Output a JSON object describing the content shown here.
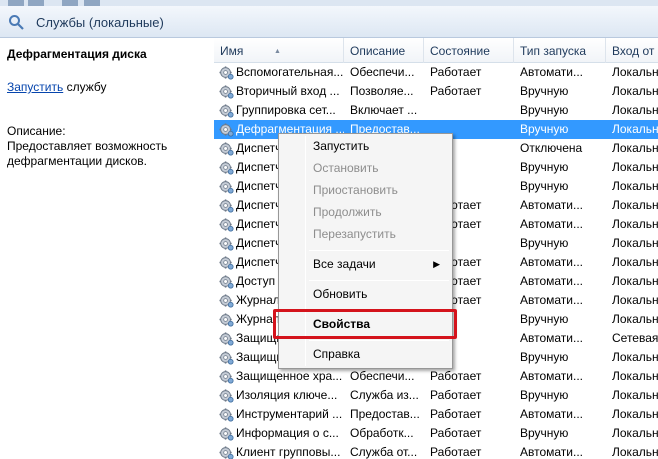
{
  "window": {
    "title": "Службы (локальные)"
  },
  "left_panel": {
    "service_title": "Дефрагментация диска",
    "start_link": "Запустить",
    "start_suffix": " службу",
    "description_label": "Описание:",
    "description_text": "Предоставляет возможность дефрагментации дисков."
  },
  "columns": [
    "Имя",
    "Описание",
    "Состояние",
    "Тип запуска",
    "Вход от и"
  ],
  "rows": [
    {
      "name": "Вспомогательная...",
      "desc": "Обеспечи...",
      "state": "Работает",
      "start": "Автомати...",
      "login": "Локальн"
    },
    {
      "name": "Вторичный вход ...",
      "desc": "Позволяе...",
      "state": "Работает",
      "start": "Вручную",
      "login": "Локальн"
    },
    {
      "name": "Группировка сет...",
      "desc": "Включает ...",
      "state": "",
      "start": "Вручную",
      "login": "Локальн"
    },
    {
      "name": "Дефрагментация ...",
      "desc": "Предостав...",
      "state": "",
      "start": "Вручную",
      "login": "Локальн"
    },
    {
      "name": "Диспетчер",
      "desc": "",
      "state": "",
      "start": "Отключена",
      "login": "Локальн"
    },
    {
      "name": "Диспетчер",
      "desc": "",
      "state": "",
      "start": "Вручную",
      "login": "Локальн"
    },
    {
      "name": "Диспетчер",
      "desc": "",
      "state": "",
      "start": "Вручную",
      "login": "Локальн"
    },
    {
      "name": "Диспетчер",
      "desc": "",
      "state": "Работает",
      "start": "Автомати...",
      "login": "Локальн"
    },
    {
      "name": "Диспетчер",
      "desc": "",
      "state": "Работает",
      "start": "Автомати...",
      "login": "Локальн"
    },
    {
      "name": "Диспетчер",
      "desc": "",
      "state": "",
      "start": "Вручную",
      "login": "Локальн"
    },
    {
      "name": "Диспетчер",
      "desc": "",
      "state": "Работает",
      "start": "Автомати...",
      "login": "Локальн"
    },
    {
      "name": "Доступ",
      "desc": "",
      "state": "Работает",
      "start": "Автомати...",
      "login": "Локальн"
    },
    {
      "name": "Журнал",
      "desc": "",
      "state": "Работает",
      "start": "Автомати...",
      "login": "Локальн"
    },
    {
      "name": "Журнал",
      "desc": "",
      "state": "",
      "start": "Вручную",
      "login": "Локальн"
    },
    {
      "name": "Защищит",
      "desc": "",
      "state": "",
      "start": "Автомати...",
      "login": "Сетевая"
    },
    {
      "name": "Защищит",
      "desc": "",
      "state": "",
      "start": "Вручную",
      "login": "Локальн"
    },
    {
      "name": "Защищенное хра...",
      "desc": "Обеспечи...",
      "state": "Работает",
      "start": "Автомати...",
      "login": "Локальн"
    },
    {
      "name": "Изоляция ключе...",
      "desc": "Служба из...",
      "state": "Работает",
      "start": "Вручную",
      "login": "Локальн"
    },
    {
      "name": "Инструментарий ...",
      "desc": "Предостав...",
      "state": "Работает",
      "start": "Автомати...",
      "login": "Локальн"
    },
    {
      "name": "Информация о с...",
      "desc": "Обработк...",
      "state": "Работает",
      "start": "Вручную",
      "login": "Локальн"
    },
    {
      "name": "Клиент групповы...",
      "desc": "Служба от...",
      "state": "Работает",
      "start": "Автомати...",
      "login": "Локальн"
    }
  ],
  "selected_row": 3,
  "context_menu": {
    "items": [
      {
        "label": "Запустить",
        "disabled": false,
        "bold": false
      },
      {
        "label": "Остановить",
        "disabled": true,
        "bold": false
      },
      {
        "label": "Приостановить",
        "disabled": true,
        "bold": false
      },
      {
        "label": "Продолжить",
        "disabled": true,
        "bold": false
      },
      {
        "label": "Перезапустить",
        "disabled": true,
        "bold": false
      },
      {
        "label": "Все задачи",
        "disabled": false,
        "bold": false,
        "submenu": true
      },
      {
        "label": "Обновить",
        "disabled": false,
        "bold": false
      },
      {
        "label": "Свойства",
        "disabled": false,
        "bold": true
      },
      {
        "label": "Справка",
        "disabled": false,
        "bold": false
      }
    ]
  },
  "colors": {
    "selection": "#3399ff",
    "highlight_box": "#d4131c",
    "link": "#0645ad"
  }
}
